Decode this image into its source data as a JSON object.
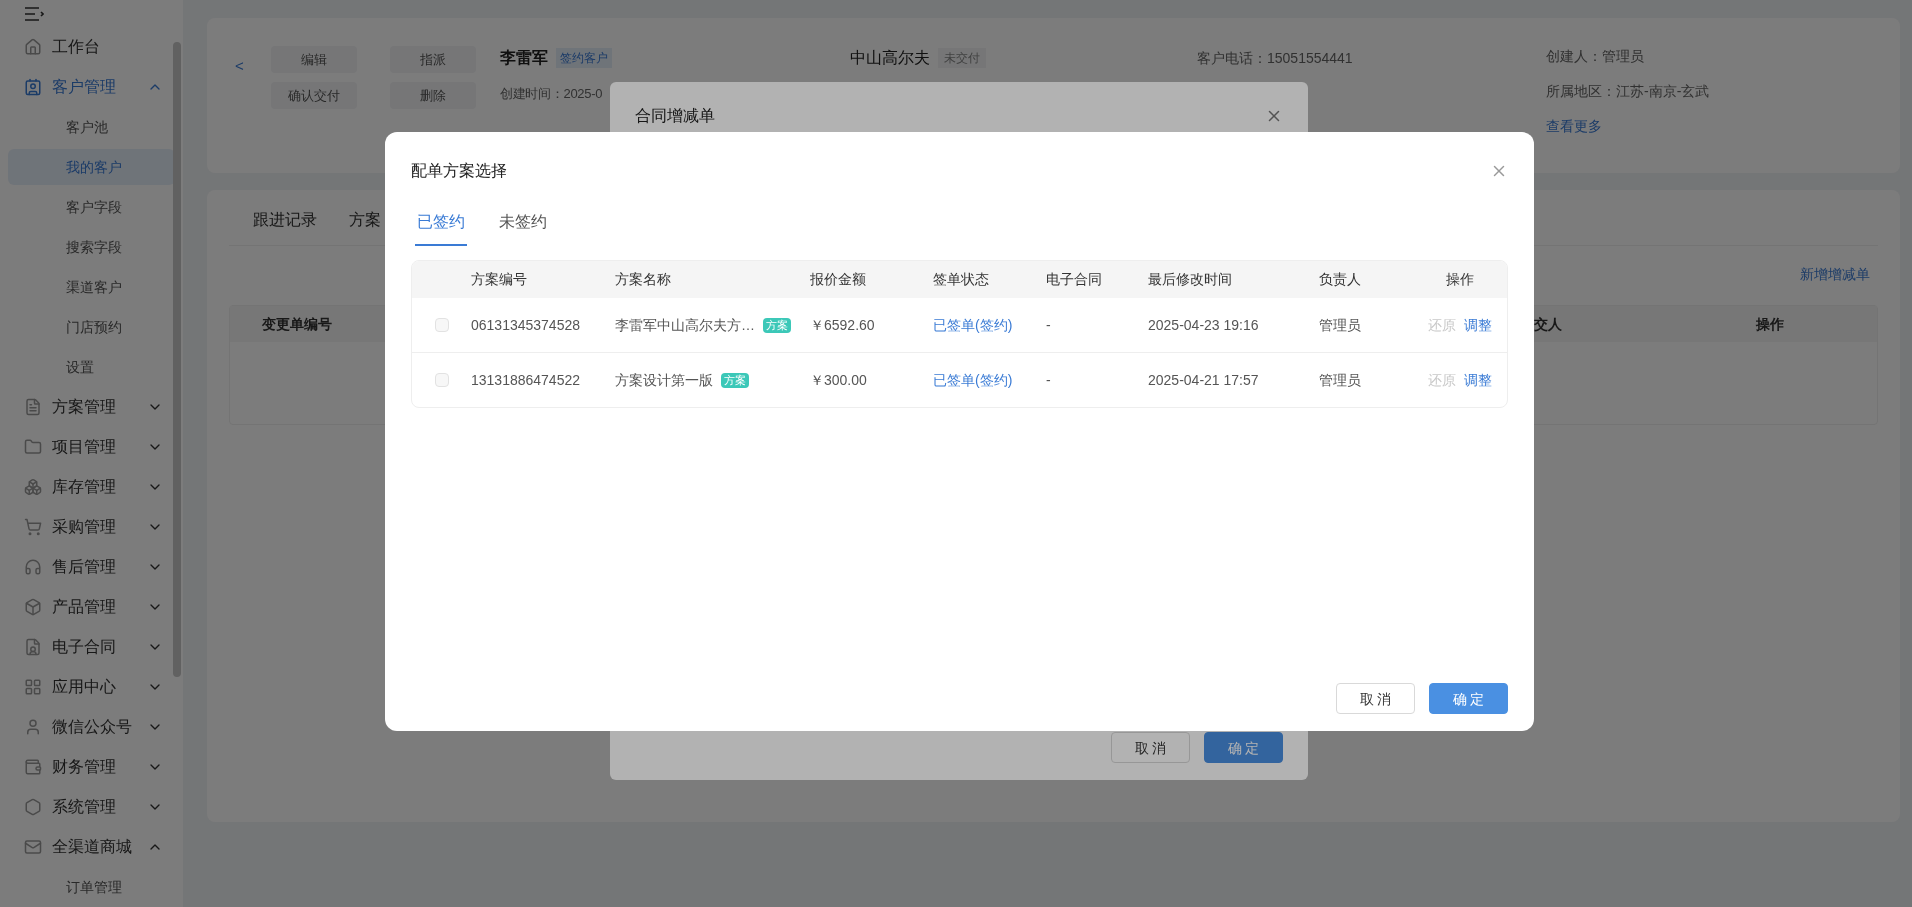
{
  "sidebar": {
    "items": [
      {
        "label": "工作台",
        "kind": "link",
        "selected": false
      },
      {
        "label": "客户管理",
        "kind": "group",
        "selected": true,
        "expanded": true,
        "children": [
          {
            "label": "客户池",
            "selected": false
          },
          {
            "label": "我的客户",
            "selected": true
          },
          {
            "label": "客户字段",
            "selected": false
          },
          {
            "label": "搜索字段",
            "selected": false
          },
          {
            "label": "渠道客户",
            "selected": false
          },
          {
            "label": "门店预约",
            "selected": false
          },
          {
            "label": "设置",
            "selected": false
          }
        ]
      },
      {
        "label": "方案管理",
        "kind": "group",
        "selected": false,
        "expanded": false
      },
      {
        "label": "项目管理",
        "kind": "group",
        "selected": false,
        "expanded": false
      },
      {
        "label": "库存管理",
        "kind": "group",
        "selected": false,
        "expanded": false
      },
      {
        "label": "采购管理",
        "kind": "group",
        "selected": false,
        "expanded": false
      },
      {
        "label": "售后管理",
        "kind": "group",
        "selected": false,
        "expanded": false
      },
      {
        "label": "产品管理",
        "kind": "group",
        "selected": false,
        "expanded": false
      },
      {
        "label": "电子合同",
        "kind": "group",
        "selected": false,
        "expanded": false
      },
      {
        "label": "应用中心",
        "kind": "group",
        "selected": false,
        "expanded": false
      },
      {
        "label": "微信公众号",
        "kind": "group",
        "selected": false,
        "expanded": false
      },
      {
        "label": "财务管理",
        "kind": "group",
        "selected": false,
        "expanded": false
      },
      {
        "label": "系统管理",
        "kind": "group",
        "selected": false,
        "expanded": false
      },
      {
        "label": "全渠道商城",
        "kind": "group",
        "selected": false,
        "expanded": true,
        "children": [
          {
            "label": "订单管理",
            "selected": false
          }
        ]
      }
    ]
  },
  "customer": {
    "back": "<",
    "actions": [
      "编辑",
      "指派",
      "确认交付",
      "删除"
    ],
    "name": "李雷军",
    "name_tag": "签约客户",
    "created": "创建时间：2025-0",
    "project": "中山高尔夫",
    "project_tag": "未交付",
    "phone": "客户电话：15051554441",
    "creator": "创建人：管理员",
    "region": "所属地区：江苏-南京-玄武",
    "more": "查看更多"
  },
  "detail_tabs": [
    {
      "label": "跟进记录",
      "selected": false
    },
    {
      "label": "方案",
      "selected": false
    }
  ],
  "add_link": "新增增减单",
  "change_table": {
    "columns": [
      "变更单编号",
      "交人",
      "操作"
    ]
  },
  "contract_dialog": {
    "title": "合同增减单",
    "buttons": [
      {
        "label": "取 消",
        "kind": "default"
      },
      {
        "label": "确 定",
        "kind": "primary"
      }
    ]
  },
  "plan_dialog": {
    "title": "配单方案选择",
    "tabs": [
      {
        "label": "已签约",
        "selected": true
      },
      {
        "label": "未签约",
        "selected": false
      }
    ],
    "columns": [
      "方案编号",
      "方案名称",
      "报价金额",
      "签单状态",
      "电子合同",
      "最后修改时间",
      "负责人",
      "操作"
    ],
    "rows": [
      {
        "checked": false,
        "code": "06131345374528",
        "name": "李雷军中山高尔夫方…",
        "tag": "方案",
        "price": "￥6592.60",
        "status": "已签单(签约)",
        "contract": "-",
        "modified": "2025-04-23 19:16",
        "owner": "管理员",
        "ops": [
          {
            "label": "还原",
            "disabled": true
          },
          {
            "label": "调整",
            "disabled": false
          }
        ]
      },
      {
        "checked": false,
        "code": "13131886474522",
        "name": "方案设计第一版",
        "tag": "方案",
        "price": "￥300.00",
        "status": "已签单(签约)",
        "contract": "-",
        "modified": "2025-04-21 17:57",
        "owner": "管理员",
        "ops": [
          {
            "label": "还原",
            "disabled": true
          },
          {
            "label": "调整",
            "disabled": false
          }
        ]
      }
    ],
    "buttons": [
      {
        "label": "取 消",
        "kind": "default"
      },
      {
        "label": "确 定",
        "kind": "primary"
      }
    ]
  }
}
